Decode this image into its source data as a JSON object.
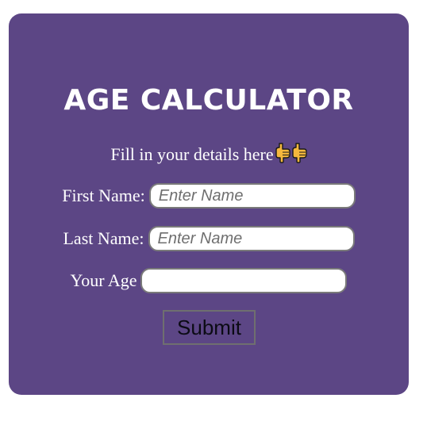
{
  "form": {
    "title": "AGE CALCULATOR",
    "subtitle": "Fill in your details here",
    "subtitle_icons": [
      "pointing-down-hand-icon",
      "pointing-down-hand-icon"
    ],
    "first_name": {
      "label": "First Name:",
      "placeholder": "Enter Name",
      "value": ""
    },
    "last_name": {
      "label": "Last Name:",
      "placeholder": "Enter Name",
      "value": ""
    },
    "age": {
      "label": "Your Age",
      "placeholder": "",
      "value": ""
    },
    "submit_label": "Submit"
  },
  "colors": {
    "card_background": "#5c4685",
    "text": "#ffffff",
    "hand_icon": "#f5b83d"
  }
}
